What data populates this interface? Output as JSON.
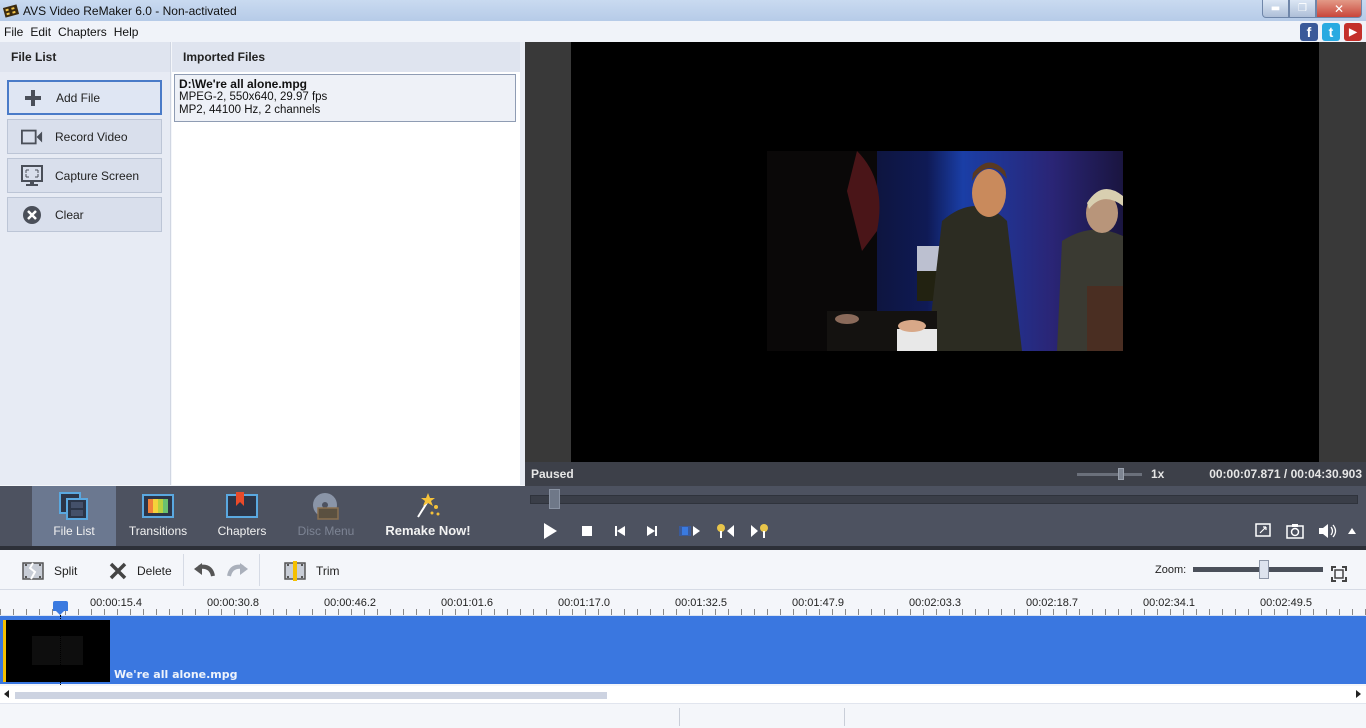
{
  "window": {
    "title": "AVS Video ReMaker 6.0 - Non-activated",
    "controls": [
      "minimize",
      "restore",
      "close"
    ]
  },
  "menu": [
    "File",
    "Edit",
    "Chapters",
    "Help"
  ],
  "social": [
    {
      "name": "facebook",
      "glyph": "f",
      "color": "#3b5a99"
    },
    {
      "name": "twitter",
      "glyph": "t",
      "color": "#29aae1"
    },
    {
      "name": "youtube",
      "glyph": "▶",
      "color": "#c4302b"
    }
  ],
  "file_list": {
    "title": "File List",
    "buttons": [
      {
        "label": "Add File",
        "icon": "plus-icon",
        "active": true
      },
      {
        "label": "Record Video",
        "icon": "camera-icon",
        "active": false
      },
      {
        "label": "Capture Screen",
        "icon": "monitor-icon",
        "active": false
      },
      {
        "label": "Clear",
        "icon": "clear-icon",
        "active": false
      }
    ]
  },
  "imported_files": {
    "title": "Imported Files",
    "items": [
      {
        "path": "D:\\We're all alone.mpg",
        "video": "MPEG-2, 550x640, 29.97 fps",
        "audio": "MP2, 44100 Hz, 2 channels"
      }
    ]
  },
  "player": {
    "status": "Paused",
    "speed": "1x",
    "current_time": "00:00:07.871",
    "separator": "/",
    "total_time": "00:04:30.903",
    "seek_fraction": 0.029
  },
  "tabs": [
    {
      "label": "File List",
      "active": true,
      "disabled": false
    },
    {
      "label": "Transitions",
      "active": false,
      "disabled": false
    },
    {
      "label": "Chapters",
      "active": false,
      "disabled": false
    },
    {
      "label": "Disc Menu",
      "active": false,
      "disabled": true
    },
    {
      "label": "Remake Now!",
      "active": false,
      "disabled": false
    }
  ],
  "toolbar": {
    "split_label": "Split",
    "delete_label": "Delete",
    "trim_label": "Trim",
    "zoom_label": "Zoom:"
  },
  "timeline": {
    "ticks": [
      "00:00:15.4",
      "00:00:30.8",
      "00:00:46.2",
      "00:01:01.6",
      "00:01:17.0",
      "00:01:32.5",
      "00:01:47.9",
      "00:02:03.3",
      "00:02:18.7",
      "00:02:34.1",
      "00:02:49.5"
    ],
    "clip_name": "We're all alone.mpg"
  }
}
